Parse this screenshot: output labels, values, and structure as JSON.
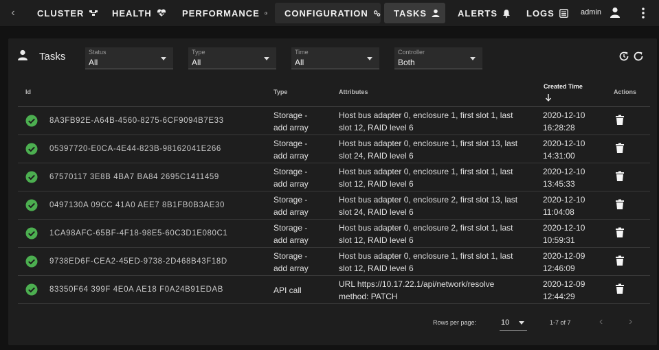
{
  "nav": {
    "items": [
      {
        "label": "CLUSTER",
        "icon": "cluster-icon"
      },
      {
        "label": "HEALTH",
        "icon": "heart-pulse-icon"
      },
      {
        "label": "PERFORMANCE",
        "icon": "speedometer-icon"
      },
      {
        "label": "CONFIGURATION",
        "icon": "cogs-icon"
      },
      {
        "label": "TASKS",
        "icon": "account-icon"
      },
      {
        "label": "ALERTS",
        "icon": "bell-icon"
      },
      {
        "label": "LOGS",
        "icon": "list-icon"
      }
    ],
    "active": "TASKS",
    "user": "admin"
  },
  "panel": {
    "title": "Tasks",
    "filters": [
      {
        "label": "Status",
        "value": "All"
      },
      {
        "label": "Type",
        "value": "All"
      },
      {
        "label": "Time",
        "value": "All"
      },
      {
        "label": "Controller",
        "value": "Both"
      }
    ]
  },
  "table": {
    "headers": {
      "id": "Id",
      "type": "Type",
      "attributes": "Attributes",
      "created": "Created Time",
      "actions": "Actions"
    },
    "rows": [
      {
        "id": "8A3FB92E-A64B-4560-8275-6CF9094B7E33",
        "type": [
          "Storage -",
          "add array"
        ],
        "attr": [
          "Host bus adapter 0, enclosure 1, first slot 1, last",
          "slot 12, RAID level 6"
        ],
        "time": [
          "2020-12-10",
          "16:28:28"
        ]
      },
      {
        "id": "05397720-E0CA-4E44-823B-98162041E266",
        "type": [
          "Storage -",
          "add array"
        ],
        "attr": [
          "Host bus adapter 0, enclosure 1, first slot 13, last",
          "slot 24, RAID level 6"
        ],
        "time": [
          "2020-12-10",
          "14:31:00"
        ]
      },
      {
        "id": "67570117 3E8B 4BA7 BA84 2695C1411459",
        "type": [
          "Storage -",
          "add array"
        ],
        "attr": [
          "Host bus adapter 0, enclosure 1, first slot 1, last",
          "slot 12, RAID level 6"
        ],
        "time": [
          "2020-12-10",
          "13:45:33"
        ]
      },
      {
        "id": "0497130A 09CC 41A0 AEE7 8B1FB0B3AE30",
        "type": [
          "Storage -",
          "add array"
        ],
        "attr": [
          "Host bus adapter 0, enclosure 2, first slot 13, last",
          "slot 24, RAID level 6"
        ],
        "time": [
          "2020-12-10",
          "11:04:08"
        ]
      },
      {
        "id": "1CA98AFC-65BF-4F18-98E5-60C3D1E080C1",
        "type": [
          "Storage -",
          "add array"
        ],
        "attr": [
          "Host bus adapter 0, enclosure 2, first slot 1, last",
          "slot 12, RAID level 6"
        ],
        "time": [
          "2020-12-10",
          "10:59:31"
        ]
      },
      {
        "id": "9738ED6F-CEA2-45ED-9738-2D468B43F18D",
        "type": [
          "Storage -",
          "add array"
        ],
        "attr": [
          "Host bus adapter 0, enclosure 1, first slot 1, last",
          "slot 12, RAID level 6"
        ],
        "time": [
          "2020-12-09",
          "12:46:09"
        ]
      },
      {
        "id": "83350F64 399F 4E0A AE18 F0A24B91EDAB",
        "type": [
          "API call",
          ""
        ],
        "attr": [
          "URL https://10.17.22.1/api/network/resolve",
          "method: PATCH"
        ],
        "time": [
          "2020-12-09",
          "12:44:29"
        ]
      }
    ]
  },
  "footer": {
    "rows_per_page_label": "Rows per page:",
    "rows_per_page": "10",
    "range": "1-7 of 7"
  },
  "colors": {
    "success": "#4caf50",
    "background": "#121212",
    "panel": "#1e1e1e"
  }
}
